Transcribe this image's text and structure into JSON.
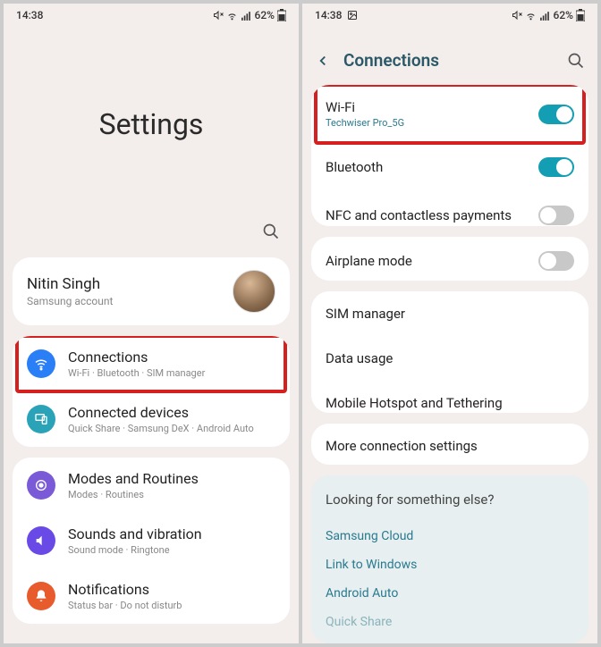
{
  "statusbar": {
    "time": "14:38",
    "battery": "62%"
  },
  "left": {
    "title": "Settings",
    "account": {
      "name": "Nitin Singh",
      "sub": "Samsung account"
    },
    "group1": {
      "connections": {
        "title": "Connections",
        "sub": "Wi-Fi · Bluetooth · SIM manager"
      },
      "connected_devices": {
        "title": "Connected devices",
        "sub": "Quick Share · Samsung DeX · Android Auto"
      }
    },
    "group2": {
      "modes": {
        "title": "Modes and Routines",
        "sub": "Modes · Routines"
      },
      "sounds": {
        "title": "Sounds and vibration",
        "sub": "Sound mode · Ringtone"
      },
      "notifications": {
        "title": "Notifications",
        "sub": "Status bar · Do not disturb"
      }
    }
  },
  "right": {
    "header": "Connections",
    "wifi": {
      "title": "Wi-Fi",
      "sub": "Techwiser Pro_5G",
      "on": true
    },
    "bluetooth": {
      "title": "Bluetooth",
      "on": true
    },
    "nfc": {
      "title": "NFC and contactless payments",
      "on": false
    },
    "airplane": {
      "title": "Airplane mode",
      "on": false
    },
    "sim": {
      "title": "SIM manager"
    },
    "data": {
      "title": "Data usage"
    },
    "hotspot": {
      "title": "Mobile Hotspot and Tethering"
    },
    "more": {
      "title": "More connection settings"
    },
    "suggest": {
      "title": "Looking for something else?",
      "links": [
        "Samsung Cloud",
        "Link to Windows",
        "Android Auto",
        "Quick Share"
      ]
    }
  }
}
